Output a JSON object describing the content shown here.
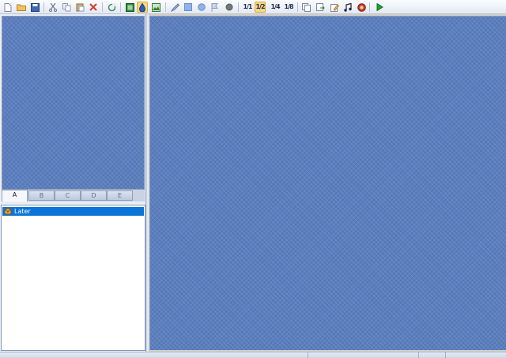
{
  "toolbar": {
    "buttons": [
      {
        "name": "new-file-icon",
        "glyph": "🗋"
      },
      {
        "name": "open-folder-icon",
        "glyph": "📂"
      },
      {
        "name": "save-icon",
        "glyph": "💾"
      },
      {
        "name": "cut-icon",
        "glyph": "✂"
      },
      {
        "name": "copy-icon",
        "glyph": "⎘"
      },
      {
        "name": "paste-icon",
        "glyph": "📋"
      },
      {
        "name": "delete-icon",
        "glyph": "✕"
      },
      {
        "name": "refresh-icon",
        "glyph": "⟳"
      },
      {
        "name": "image-view-icon",
        "glyph": "▣"
      },
      {
        "name": "paint-bucket-icon",
        "glyph": "⛁"
      },
      {
        "name": "picture-icon",
        "glyph": "🖼"
      },
      {
        "name": "pen-icon",
        "glyph": "✎"
      },
      {
        "name": "square-tool-icon",
        "glyph": "■"
      },
      {
        "name": "circle-tool-icon",
        "glyph": "●"
      },
      {
        "name": "flag-tool-icon",
        "glyph": "⚑"
      },
      {
        "name": "dot-tool-icon",
        "glyph": "●"
      },
      {
        "name": "note-one-whole",
        "text": "1/1"
      },
      {
        "name": "note-one-half",
        "text": "1/2"
      },
      {
        "name": "note-one-quarter",
        "text": "1/4"
      },
      {
        "name": "note-one-eighth",
        "text": "1/8"
      },
      {
        "name": "page-copy-icon",
        "glyph": "⧉"
      },
      {
        "name": "export-icon",
        "glyph": "⇲"
      },
      {
        "name": "edit-note-icon",
        "glyph": "📝"
      },
      {
        "name": "music-note-icon",
        "glyph": "♫"
      },
      {
        "name": "settings-face-icon",
        "glyph": "☻"
      },
      {
        "name": "play-icon",
        "glyph": "▶"
      }
    ]
  },
  "tabs": [
    {
      "label": "A",
      "active": true
    },
    {
      "label": "B",
      "active": false
    },
    {
      "label": "C",
      "active": false
    },
    {
      "label": "D",
      "active": false
    },
    {
      "label": "E",
      "active": false
    }
  ],
  "list": {
    "items": [
      {
        "label": "Later",
        "selected": true
      }
    ]
  },
  "colors": {
    "accent": "#0a74d8",
    "canvas": "#5b7fbe",
    "active_button": "#fbd77e"
  }
}
